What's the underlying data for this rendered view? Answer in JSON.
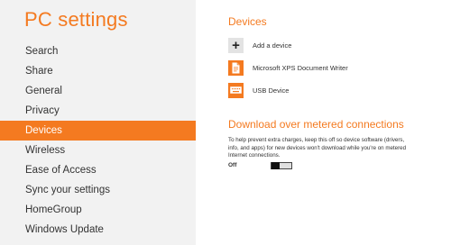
{
  "app_title": "PC settings",
  "sidebar": {
    "items": [
      {
        "label": "Search"
      },
      {
        "label": "Share"
      },
      {
        "label": "General"
      },
      {
        "label": "Privacy"
      },
      {
        "label": "Devices",
        "selected": true
      },
      {
        "label": "Wireless"
      },
      {
        "label": "Ease of Access"
      },
      {
        "label": "Sync your settings"
      },
      {
        "label": "HomeGroup"
      },
      {
        "label": "Windows Update"
      }
    ]
  },
  "devices": {
    "heading": "Devices",
    "add_label": "Add a device",
    "items": [
      {
        "label": "Microsoft XPS Document Writer",
        "icon": "printer-icon"
      },
      {
        "label": "USB Device",
        "icon": "keyboard-icon"
      }
    ]
  },
  "metered": {
    "heading": "Download over metered connections",
    "description": "To help prevent extra charges, keep this off so device software (drivers, info, and apps) for new devices won't download while you're on metered Internet connections.",
    "toggle_state": "Off"
  },
  "colors": {
    "accent": "#f47a20",
    "sidebar_bg": "#f2f2f2",
    "text": "#333333"
  }
}
